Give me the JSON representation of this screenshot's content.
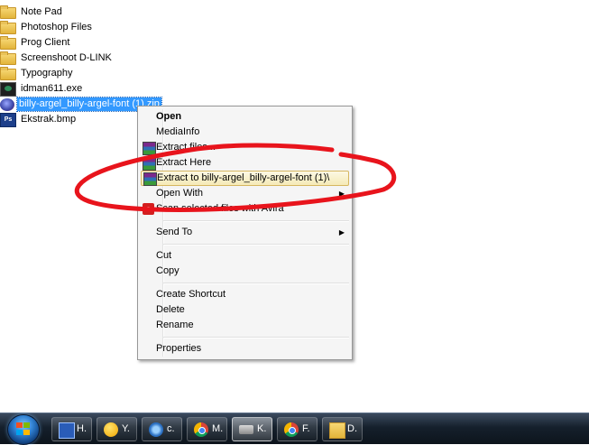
{
  "files": [
    {
      "name": "Note Pad",
      "icon": "folder-icon"
    },
    {
      "name": "Photoshop Files",
      "icon": "folder-icon"
    },
    {
      "name": "Prog Client",
      "icon": "folder-icon"
    },
    {
      "name": "Screenshoot D-LINK",
      "icon": "folder-icon"
    },
    {
      "name": "Typography",
      "icon": "folder-icon"
    },
    {
      "name": "idman611.exe",
      "icon": "exe-icon"
    },
    {
      "name": "billy-argel_billy-argel-font (1).zip",
      "icon": "zip-icon",
      "selected": true
    },
    {
      "name": "Ekstrak.bmp",
      "icon": "bmp-icon"
    }
  ],
  "context_menu": {
    "items": [
      {
        "label": "Open",
        "bold": true
      },
      {
        "label": "MediaInfo"
      },
      {
        "label": "Extract files...",
        "icon": "winrar-icon"
      },
      {
        "label": "Extract Here",
        "icon": "winrar-icon"
      },
      {
        "label": "Extract to billy-argel_billy-argel-font (1)\\",
        "icon": "winrar-icon",
        "highlighted": true
      },
      {
        "label": "Open With",
        "submenu": true
      },
      {
        "label": "Scan selected files with Avira",
        "icon": "avira-icon"
      },
      {
        "label": "Send To",
        "submenu": true
      },
      {
        "label": "Cut"
      },
      {
        "label": "Copy"
      },
      {
        "label": "Create Shortcut"
      },
      {
        "label": "Delete"
      },
      {
        "label": "Rename"
      },
      {
        "label": "Properties"
      }
    ],
    "submenu_arrow": "▶",
    "avira_glyph": "a"
  },
  "annotation": {
    "color": "#e8141c"
  },
  "taskbar": {
    "buttons": [
      {
        "label": "H.",
        "icon": "window-icon"
      },
      {
        "label": "Y.",
        "icon": "yahoo-messenger-icon"
      },
      {
        "label": "c.",
        "icon": "internet-explorer-icon"
      },
      {
        "label": "M.",
        "icon": "chrome-icon"
      },
      {
        "label": "K.",
        "icon": "drive-icon",
        "active": true
      },
      {
        "label": "F.",
        "icon": "chrome-icon"
      },
      {
        "label": "D.",
        "icon": "folder-icon"
      }
    ]
  },
  "colors": {
    "selection": "#3399ff",
    "menu_highlight": "#f5eab6",
    "taskbar": "#15202c"
  }
}
